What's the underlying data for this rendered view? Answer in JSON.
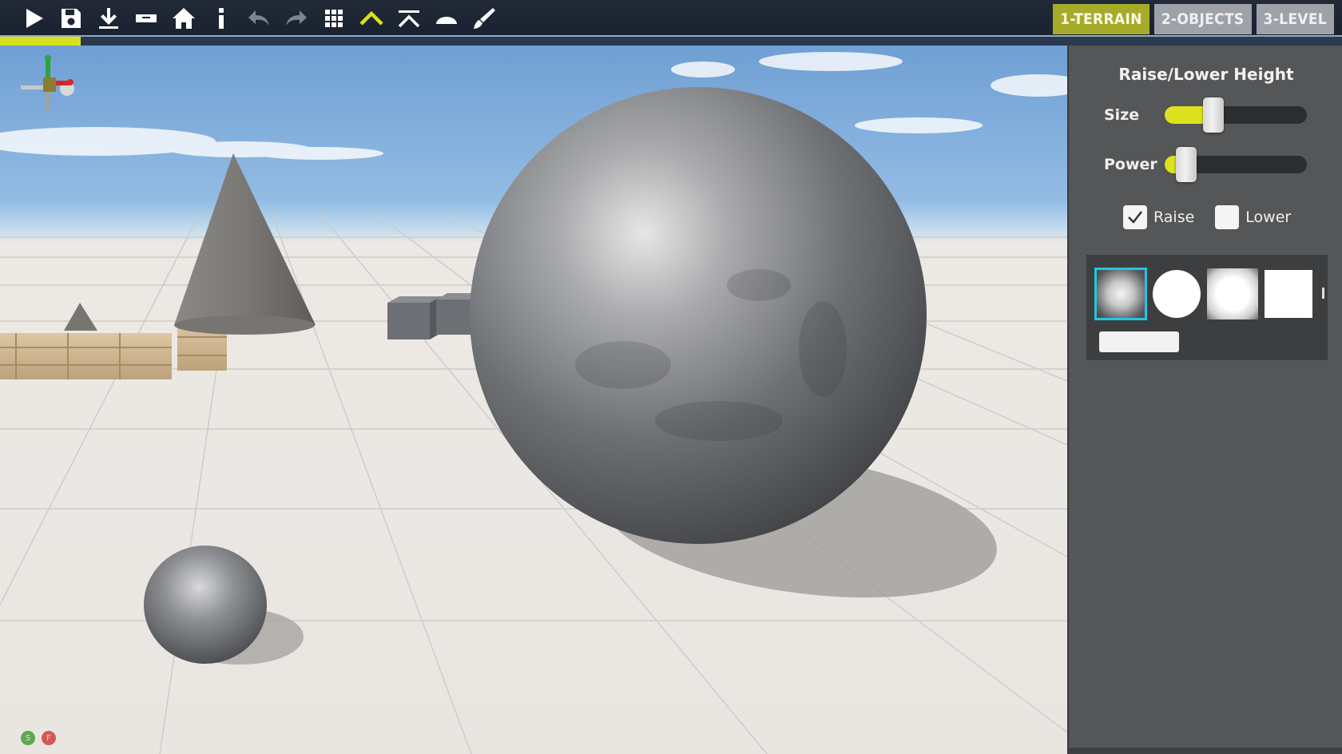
{
  "toolbar": {
    "tools": [
      {
        "name": "play-icon",
        "color": "#ffffff",
        "enabled": true
      },
      {
        "name": "save-icon",
        "color": "#ffffff",
        "enabled": true
      },
      {
        "name": "download-icon",
        "color": "#ffffff",
        "enabled": true
      },
      {
        "name": "keyboard-icon",
        "color": "#ffffff",
        "enabled": true
      },
      {
        "name": "home-icon",
        "color": "#ffffff",
        "enabled": true
      },
      {
        "name": "info-icon",
        "color": "#ffffff",
        "enabled": true
      },
      {
        "name": "undo-icon",
        "color": "#7c8494",
        "enabled": false
      },
      {
        "name": "redo-icon",
        "color": "#7c8494",
        "enabled": false
      },
      {
        "name": "grid-icon",
        "color": "#ffffff",
        "enabled": true
      },
      {
        "name": "raise-terrain-icon",
        "color": "#d8e21c",
        "enabled": true
      },
      {
        "name": "flatten-terrain-icon",
        "color": "#ffffff",
        "enabled": true
      },
      {
        "name": "smooth-terrain-icon",
        "color": "#ffffff",
        "enabled": true
      },
      {
        "name": "paint-brush-icon",
        "color": "#ffffff",
        "enabled": true
      }
    ],
    "mode_tabs": [
      {
        "label": "1-TERRAIN",
        "active": true
      },
      {
        "label": "2-OBJECTS",
        "active": false
      },
      {
        "label": "3-LEVEL",
        "active": false
      }
    ],
    "progress": 0.06
  },
  "viewport": {
    "status_dots": [
      {
        "label": "S",
        "color": "#5ea84f"
      },
      {
        "label": "F",
        "color": "#d05a55"
      }
    ]
  },
  "panel": {
    "title": "Raise/Lower Height",
    "size": {
      "label": "Size",
      "value": 0.34
    },
    "power": {
      "label": "Power",
      "value": 0.15
    },
    "raise": {
      "label": "Raise",
      "checked": true
    },
    "lower": {
      "label": "Lower",
      "checked": false
    },
    "brushes": [
      "soft-round",
      "hard-round",
      "blurred-square",
      "hard-square"
    ],
    "selected_brush": 0
  }
}
